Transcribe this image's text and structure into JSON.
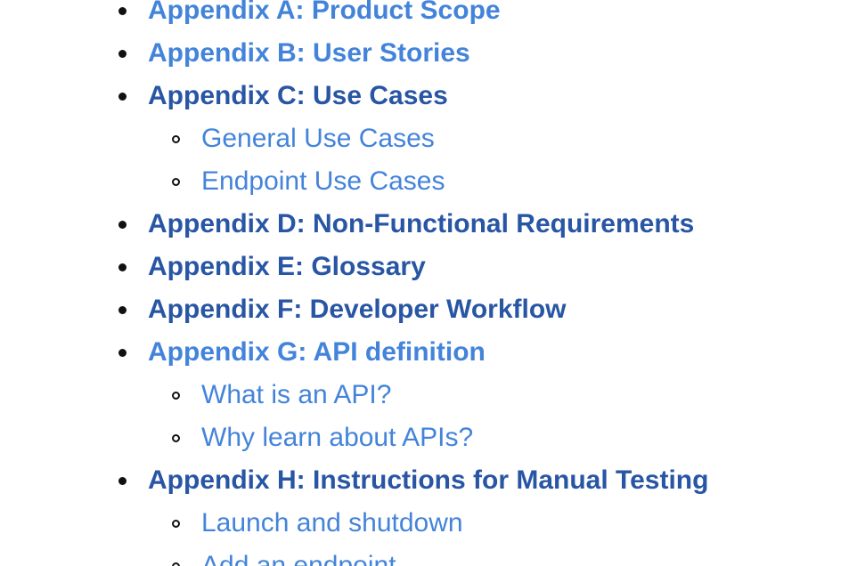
{
  "toc": {
    "items": [
      {
        "label": "Appendix A: Product Scope",
        "level": 1,
        "style": "light"
      },
      {
        "label": "Appendix B: User Stories",
        "level": 1,
        "style": "light"
      },
      {
        "label": "Appendix C: Use Cases",
        "level": 1,
        "style": "dark"
      },
      {
        "label": "General Use Cases",
        "level": 2,
        "style": "light"
      },
      {
        "label": "Endpoint Use Cases",
        "level": 2,
        "style": "light"
      },
      {
        "label": "Appendix D: Non-Functional Requirements",
        "level": 1,
        "style": "dark"
      },
      {
        "label": "Appendix E: Glossary",
        "level": 1,
        "style": "dark"
      },
      {
        "label": "Appendix F: Developer Workflow",
        "level": 1,
        "style": "dark"
      },
      {
        "label": "Appendix G: API definition",
        "level": 1,
        "style": "light"
      },
      {
        "label": "What is an API?",
        "level": 2,
        "style": "light"
      },
      {
        "label": "Why learn about APIs?",
        "level": 2,
        "style": "light"
      },
      {
        "label": "Appendix H: Instructions for Manual Testing",
        "level": 1,
        "style": "dark"
      },
      {
        "label": "Launch and shutdown",
        "level": 2,
        "style": "light"
      },
      {
        "label": "Add an endpoint",
        "level": 2,
        "style": "light"
      }
    ]
  },
  "colors": {
    "link_light": "#4384da",
    "link_dark": "#2856a4",
    "bullet": "#111111",
    "background": "#ffffff"
  }
}
